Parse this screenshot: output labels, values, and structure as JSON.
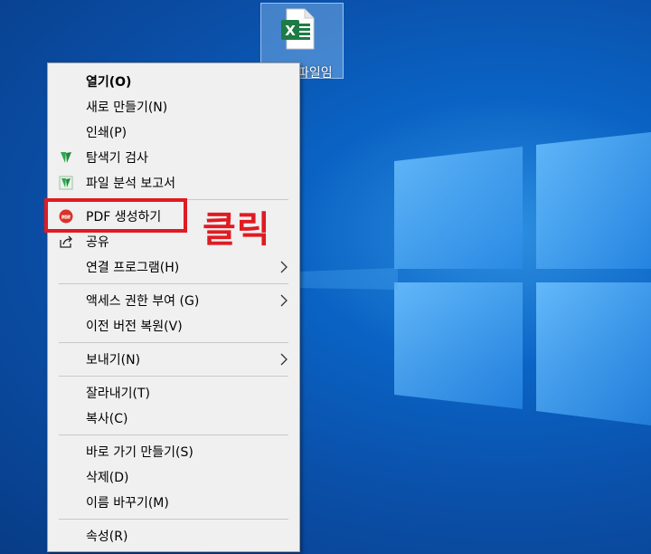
{
  "desktop": {
    "icon_label": "파일임",
    "icon_glyph_letter": "X"
  },
  "menu": {
    "items": [
      {
        "label": "열기(O)",
        "bold": true
      },
      {
        "label": "새로 만들기(N)"
      },
      {
        "label": "인쇄(P)"
      },
      {
        "label": "탐색기 검사",
        "icon": "v3-shield-icon"
      },
      {
        "label": "파일 분석 보고서",
        "icon": "v3-report-icon"
      },
      {
        "label": "PDF 생성하기",
        "icon": "pdf-icon"
      },
      {
        "label": "공유",
        "icon": "share-icon"
      },
      {
        "label": "연결 프로그램(H)",
        "submenu": true
      },
      {
        "label": "액세스 권한 부여 (G)",
        "submenu": true
      },
      {
        "label": "이전 버전 복원(V)"
      },
      {
        "label": "보내기(N)",
        "submenu": true
      },
      {
        "label": "잘라내기(T)"
      },
      {
        "label": "복사(C)"
      },
      {
        "label": "바로 가기 만들기(S)"
      },
      {
        "label": "삭제(D)"
      },
      {
        "label": "이름 바꾸기(M)"
      },
      {
        "label": "속성(R)"
      }
    ]
  },
  "annotation": {
    "text": "클릭",
    "color": "#e01b22"
  },
  "colors": {
    "desktop_bg": "#0a56b4",
    "menu_bg": "#f0f0f0",
    "excel_green": "#1e7b45",
    "v3_green": "#2fa84f"
  }
}
